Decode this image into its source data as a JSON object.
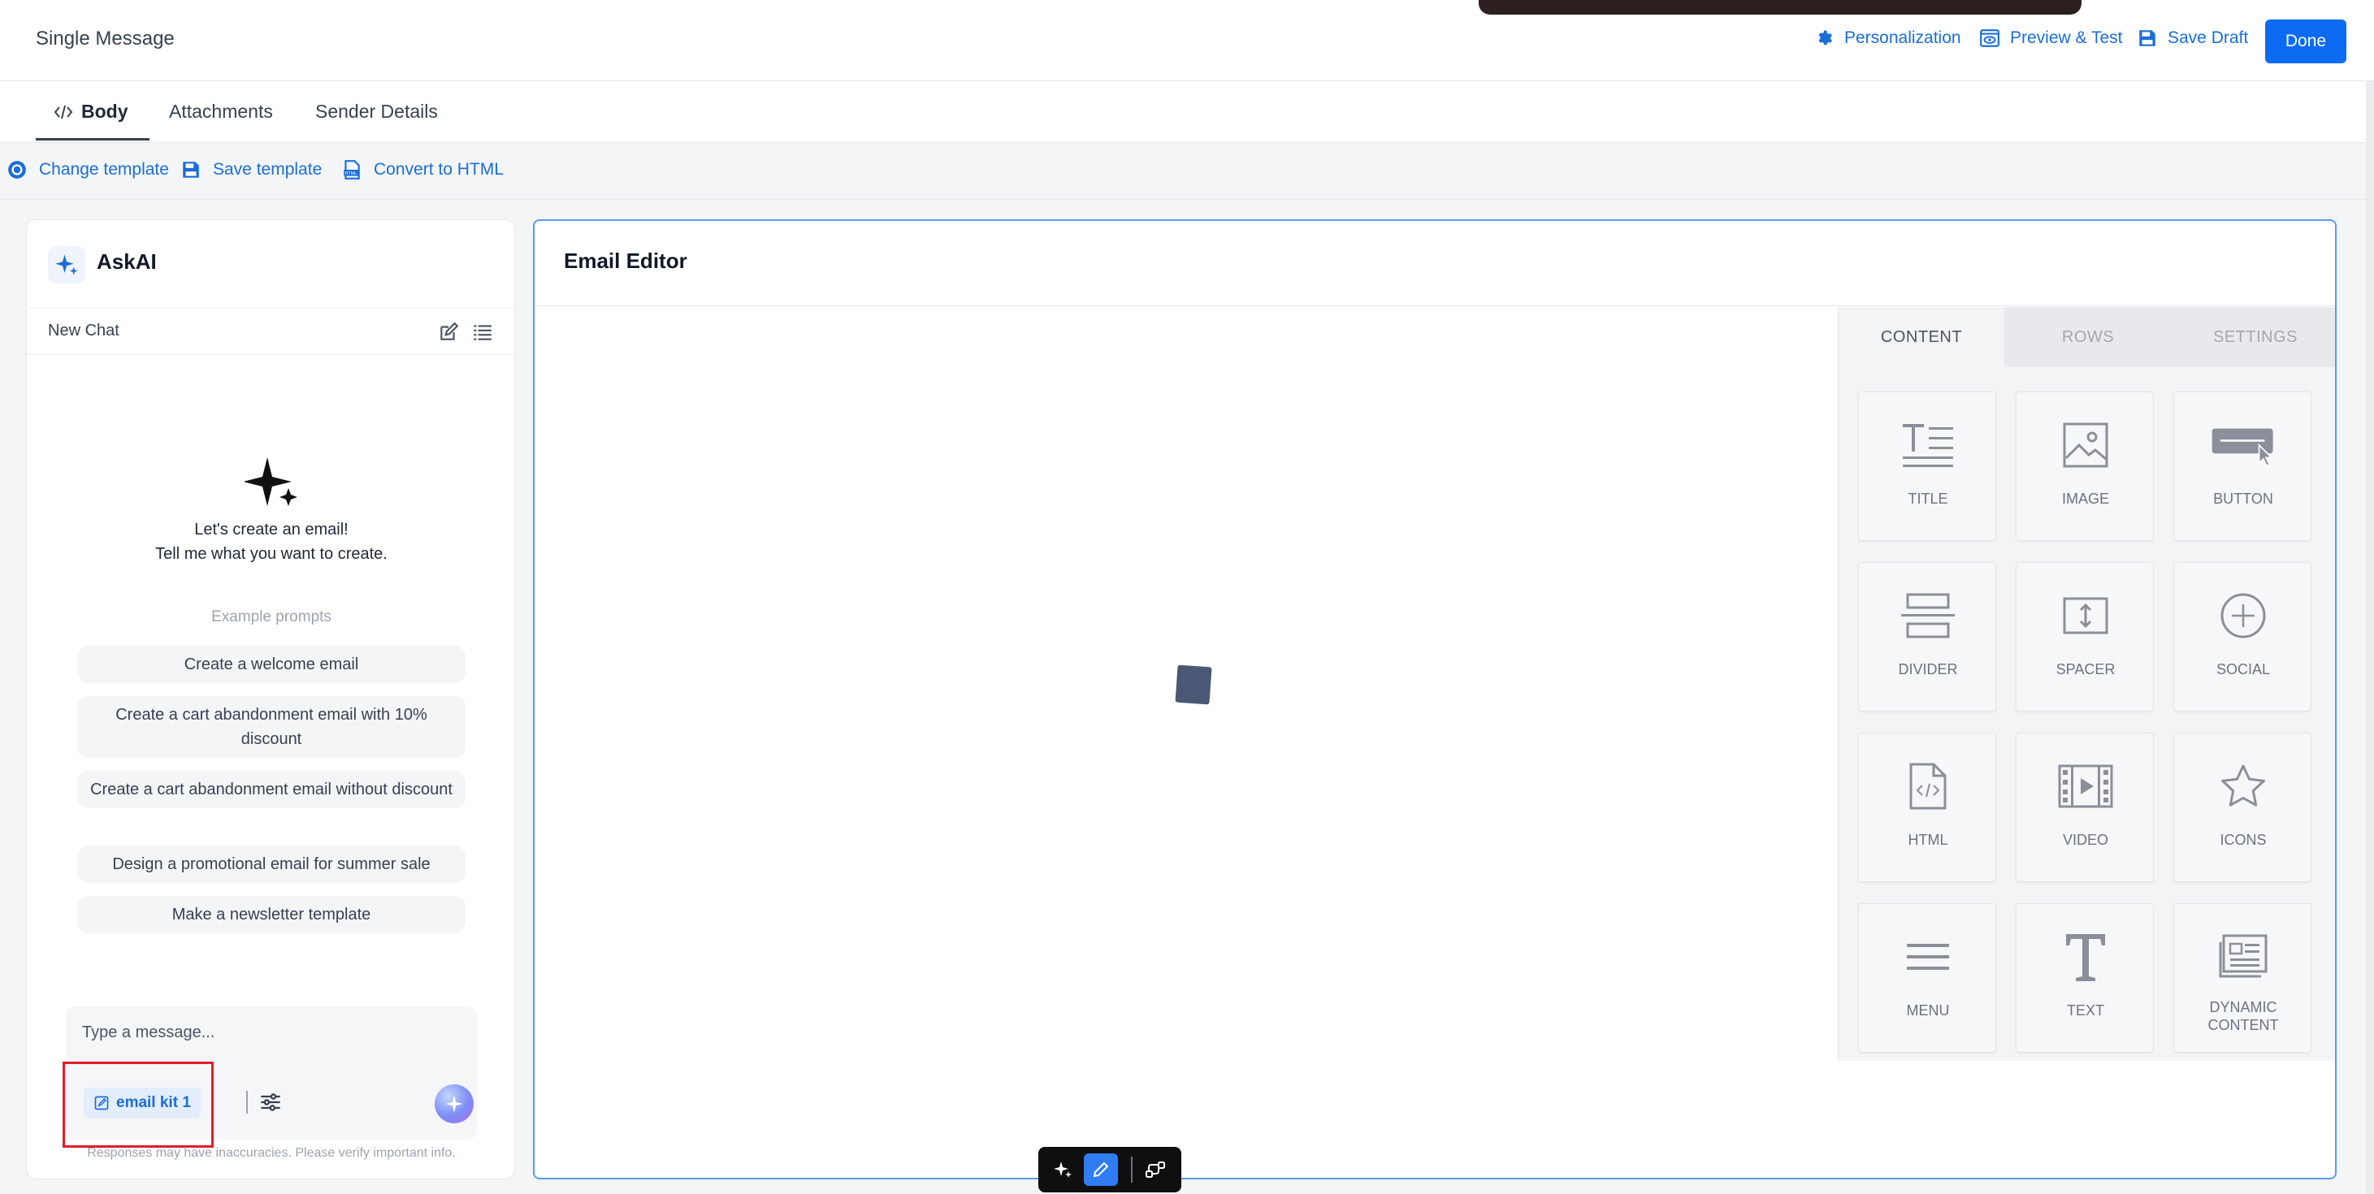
{
  "header": {
    "title": "Single Message",
    "personalization_label": "Personalization",
    "preview_label": "Preview & Test",
    "save_draft_label": "Save Draft",
    "done_label": "Done"
  },
  "tabs": [
    {
      "label": "Body"
    },
    {
      "label": "Attachments"
    },
    {
      "label": "Sender Details"
    }
  ],
  "toolbar": {
    "change_template": "Change template",
    "save_template": "Save template",
    "convert_html": "Convert to HTML"
  },
  "askai": {
    "title": "AskAI",
    "new_chat": "New Chat",
    "intro_line1": "Let's create an email!",
    "intro_line2": "Tell me what you want to create.",
    "examples_label": "Example prompts",
    "prompts": [
      "Create a welcome email",
      "Create a cart abandonment email with 10% discount",
      "Create a cart abandonment email without discount",
      "Design a promotional email for summer sale",
      "Make a newsletter template"
    ],
    "input_placeholder": "Type a message...",
    "kit_chip": "email kit 1",
    "disclaimer": "Responses may have inaccuracies. Please verify important info."
  },
  "editor": {
    "title": "Email Editor",
    "side_tabs": [
      "CONTENT",
      "ROWS",
      "SETTINGS"
    ],
    "blocks": [
      {
        "label": "TITLE",
        "icon": "title-icon"
      },
      {
        "label": "IMAGE",
        "icon": "image-icon"
      },
      {
        "label": "BUTTON",
        "icon": "button-icon"
      },
      {
        "label": "DIVIDER",
        "icon": "divider-icon"
      },
      {
        "label": "SPACER",
        "icon": "spacer-icon"
      },
      {
        "label": "SOCIAL",
        "icon": "social-icon"
      },
      {
        "label": "HTML",
        "icon": "html-icon"
      },
      {
        "label": "VIDEO",
        "icon": "video-icon"
      },
      {
        "label": "ICONS",
        "icon": "star-icon"
      },
      {
        "label": "MENU",
        "icon": "menu-icon"
      },
      {
        "label": "TEXT",
        "icon": "text-icon"
      },
      {
        "label": "DYNAMIC CONTENT",
        "icon": "dynamic-content-icon"
      }
    ]
  },
  "colors": {
    "accent": "#1a6ed8",
    "done_button": "#0b6bf2",
    "highlight": "#e11d2c"
  }
}
